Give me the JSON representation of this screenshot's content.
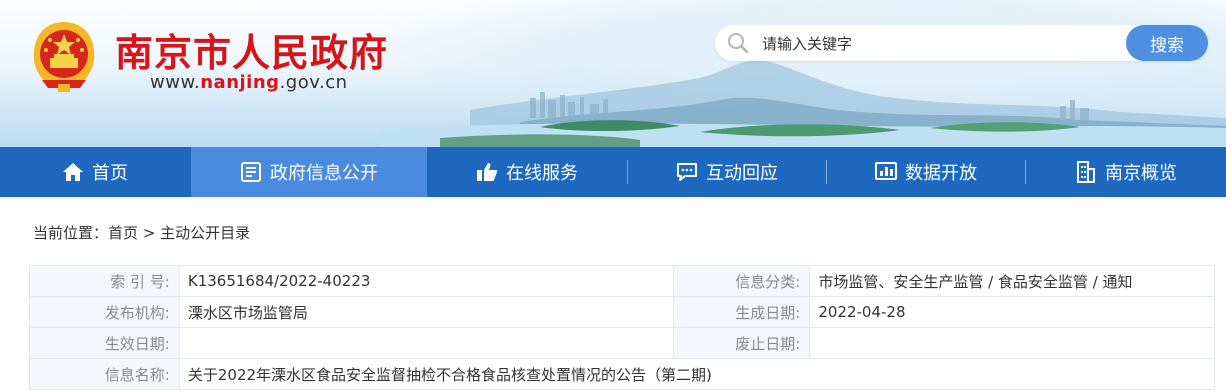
{
  "header": {
    "site_title": "南京市人民政府",
    "site_url_prefix": "www.",
    "site_url_brand": "nanjing",
    "site_url_suffix": ".gov.cn"
  },
  "search": {
    "placeholder": "请输入关键字",
    "button_label": "搜索"
  },
  "nav": {
    "items": [
      {
        "label": "首页",
        "icon": "home-icon"
      },
      {
        "label": "政府信息公开",
        "icon": "document-icon"
      },
      {
        "label": "在线服务",
        "icon": "thumbs-up-icon"
      },
      {
        "label": "互动回应",
        "icon": "chat-icon"
      },
      {
        "label": "数据开放",
        "icon": "data-chart-icon"
      },
      {
        "label": "南京概览",
        "icon": "building-icon"
      }
    ],
    "active_index": 1
  },
  "breadcrumb": {
    "prefix": "当前位置：",
    "items": [
      "首页",
      "主动公开目录"
    ],
    "separator": ">"
  },
  "info": {
    "rows": [
      {
        "k1": "索 引 号:",
        "v1": "K13651684/2022-40223",
        "k2": "信息分类:",
        "v2": "市场监管、安全生产监管 / 食品安全监管 / 通知"
      },
      {
        "k1": "发布机构:",
        "v1": "溧水区市场监管局",
        "k2": "生成日期:",
        "v2": "2022-04-28"
      },
      {
        "k1": "生效日期:",
        "v1": "",
        "k2": "废止日期:",
        "v2": ""
      }
    ],
    "title_row": {
      "k": "信息名称:",
      "v": "关于2022年溧水区食品安全监督抽检不合格食品核查处置情况的公告（第二期)"
    }
  },
  "colors": {
    "title_red": "#d4151a",
    "nav_blue": "#1e68c0",
    "nav_active": "#4a8be0",
    "search_button": "#4d8fe0"
  }
}
